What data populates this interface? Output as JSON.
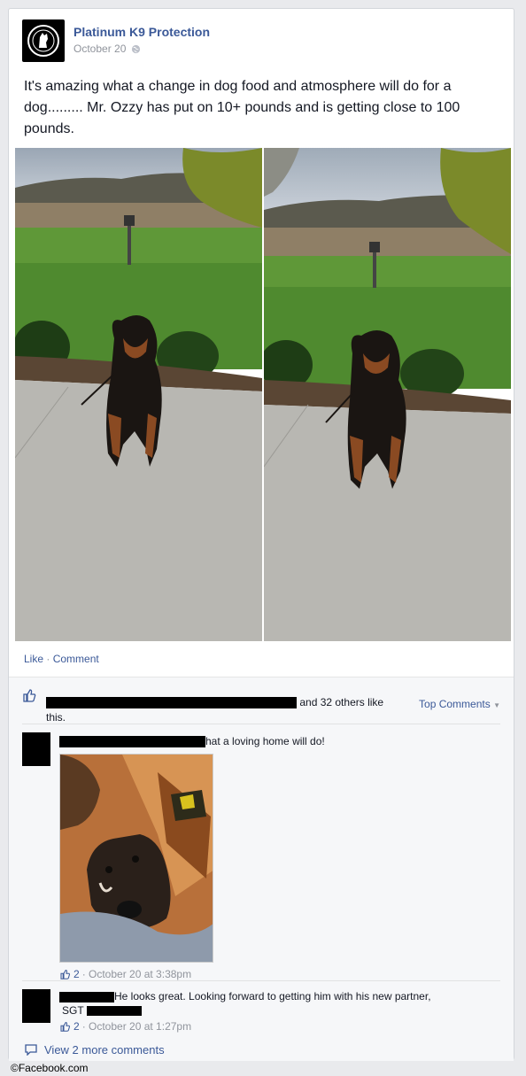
{
  "post": {
    "page_name": "Platinum K9 Protection",
    "date": "October 20",
    "text": "It's amazing what a change in dog food and atmosphere will do for a dog......... Mr. Ozzy has put on 10+ pounds and is getting close to 100 pounds.",
    "privacy_icon": "globe-icon"
  },
  "actions": {
    "like": "Like",
    "separator": "·",
    "comment": "Comment"
  },
  "likes": {
    "suffix": "and 32 others like this.",
    "top_comments": "Top Comments",
    "top_comments_icon": "caret-down-icon"
  },
  "comments": [
    {
      "text": "hat a loving home will do!",
      "likes": "2",
      "timestamp": "· October 20 at 3:38pm"
    },
    {
      "text": "He looks great. Looking forward to getting him with his new partner,",
      "text2": "SGT",
      "likes": "2",
      "timestamp": "· October 20 at 1:27pm"
    }
  ],
  "view_more": "View 2 more comments",
  "copyright": "©Facebook.com",
  "colors": {
    "link": "#3b5998",
    "meta": "#90949c",
    "background": "#e9eaed"
  }
}
